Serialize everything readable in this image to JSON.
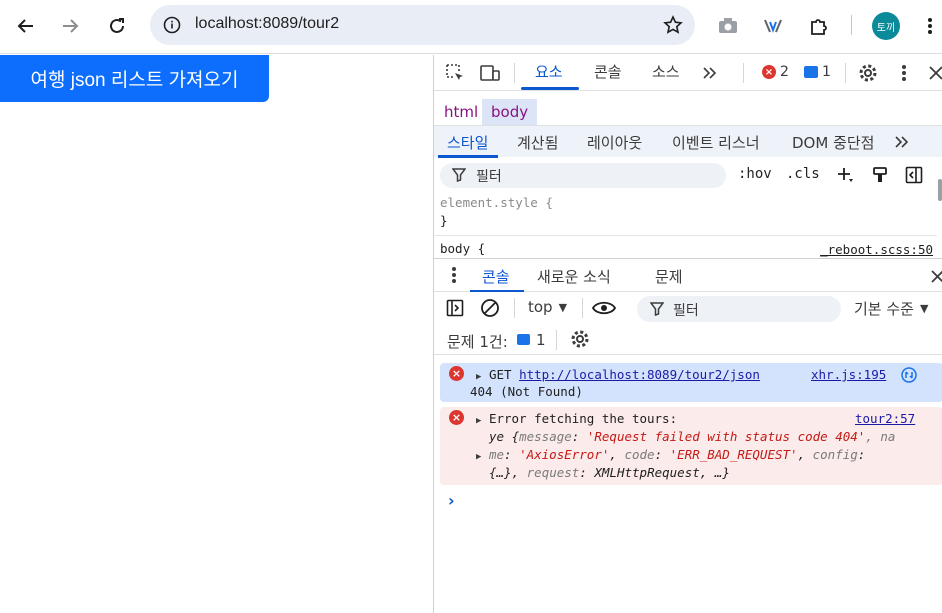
{
  "browser": {
    "url": "localhost:8089/tour2",
    "profile_initials": "토끼",
    "icons": [
      "back-arrow-icon",
      "forward-arrow-icon",
      "reload-icon",
      "site-info-icon",
      "bookmark-star-icon",
      "camera-icon",
      "extension-devtools-icon",
      "extensions-puzzle-icon",
      "kebab-menu-icon"
    ]
  },
  "page": {
    "fetch_button": "여행 json 리스트 가져오기",
    "button_color": "#0d6efd"
  },
  "devtools": {
    "tabs": [
      "요소",
      "콘솔",
      "소스"
    ],
    "active_tab": "요소",
    "error_count": "2",
    "message_count": "1",
    "breadcrumbs": [
      "html",
      "body"
    ],
    "style_tabs": [
      "스타일",
      "계산됨",
      "레이아웃",
      "이벤트 리스너",
      "DOM 중단점"
    ],
    "styles_filter_placeholder": "필터",
    "hov": ":hov",
    "cls": ".cls",
    "element_style": "element.style {",
    "close_brace": "}",
    "body_selector": "body {",
    "body_source": "_reboot.scss:50",
    "drawer_tabs": [
      "콘솔",
      "새로운 소식",
      "문제"
    ],
    "console_context": "top",
    "console_filter_placeholder": "필터",
    "log_level": "기본 수준",
    "issues_label": "문제 1건:",
    "issues_count": "1",
    "messages": {
      "net_method": "GET",
      "net_url": "http://localhost:8089/tour2/json",
      "net_source": "xhr.js:195",
      "net_status": "404 (Not Found)",
      "err_title": "Error fetching the tours:",
      "err_source": "tour2:57",
      "err_l2_a": "ye {",
      "err_l2_k1": "message",
      "err_l2_v1": "'Request failed with status code 404'",
      "err_l2_tail": ", na",
      "err_l3_a": "me",
      "err_l3_v1": "'AxiosError'",
      "err_l3_k2": "code",
      "err_l3_v2": "'ERR_BAD_REQUEST'",
      "err_l3_k3": "config",
      "err_l4_a": "{…}, ",
      "err_l4_k": "request",
      "err_l4_v": "XMLHttpRequest, …}"
    },
    "accent": "#0b57d0",
    "error_bg": "#fcebeb",
    "network_bg": "#d3e3fd"
  }
}
